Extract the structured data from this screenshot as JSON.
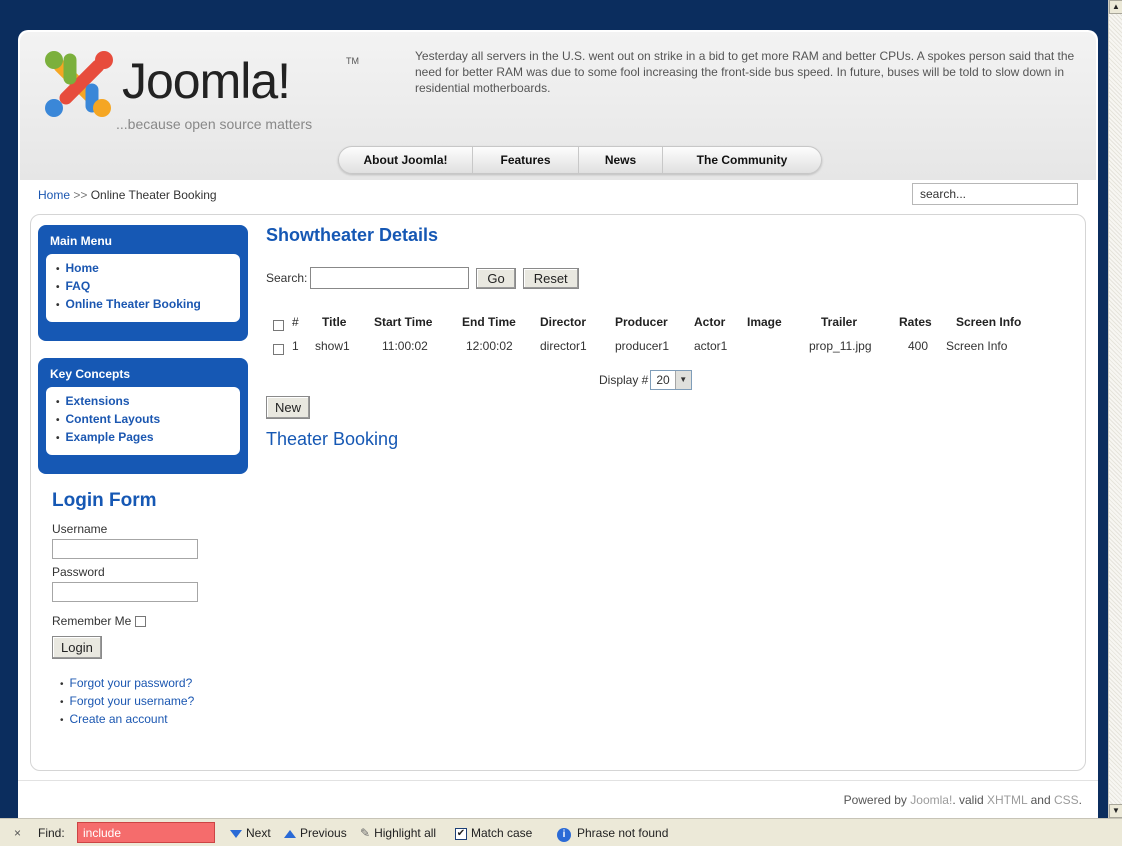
{
  "header": {
    "logo_text": "Joomla!",
    "logo_tm": "TM",
    "tagline": "...because open source matters",
    "news": "Yesterday all servers in the U.S. went out on strike in a bid to get more RAM and better CPUs. A spokes person said that the need for better RAM was due to some fool increasing the front-side bus speed. In future, buses will be told to slow down in residential motherboards."
  },
  "nav": [
    "About Joomla!",
    "Features",
    "News",
    "The Community"
  ],
  "breadcrumb": {
    "home": "Home",
    "sep": ">>",
    "current": "Online Theater Booking"
  },
  "search": {
    "value": "search..."
  },
  "main_menu": {
    "title": "Main Menu",
    "items": [
      "Home",
      "FAQ",
      "Online Theater Booking"
    ]
  },
  "key_concepts": {
    "title": "Key Concepts",
    "items": [
      "Extensions",
      "Content Layouts",
      "Example Pages"
    ]
  },
  "login": {
    "title": "Login Form",
    "username_label": "Username",
    "password_label": "Password",
    "remember_label": "Remember Me",
    "button": "Login",
    "links": [
      "Forgot your password?",
      "Forgot your username?",
      "Create an account"
    ]
  },
  "content": {
    "title": "Showtheater Details",
    "search_label": "Search:",
    "go": "Go",
    "reset": "Reset",
    "columns": [
      "#",
      "Title",
      "Start Time",
      "End Time",
      "Director",
      "Producer",
      "Actor",
      "Image",
      "Trailer",
      "Rates",
      "Screen Info"
    ],
    "row": {
      "num": "1",
      "title": "show1",
      "start": "11:00:02",
      "end": "12:00:02",
      "director": "director1",
      "producer": "producer1",
      "actor": "actor1",
      "image": "",
      "trailer": "prop_11.jpg",
      "rates": "400",
      "screen_info": "Screen Info"
    },
    "display_label": "Display #",
    "display_value": "20",
    "new_button": "New",
    "subtitle": "Theater Booking"
  },
  "footer": {
    "prefix": "Powered by",
    "joomla": "Joomla!",
    "mid": ". valid",
    "xhtml": "XHTML",
    "and": "and",
    "css": "CSS",
    "end": "."
  },
  "findbar": {
    "close": "×",
    "label": "Find:",
    "value": "include",
    "next": "Next",
    "previous": "Previous",
    "highlight": "Highlight all",
    "match": "Match case",
    "status": "Phrase not found"
  }
}
